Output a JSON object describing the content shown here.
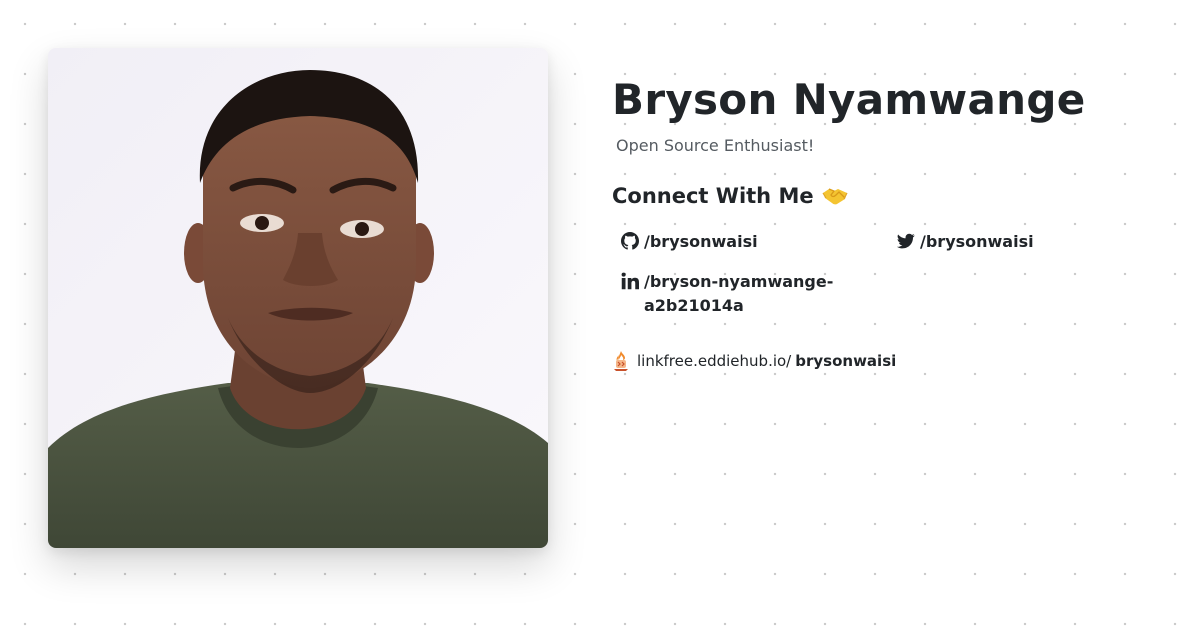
{
  "profile": {
    "name": "Bryson Nyamwange",
    "tagline": "Open Source Enthusiast!",
    "avatar_alt": "profile-photo"
  },
  "connect": {
    "heading": "Connect With Me",
    "emoji_icon": "handshake-icon"
  },
  "socials": [
    {
      "platform": "github",
      "icon": "github-icon",
      "label": "/brysonwaisi"
    },
    {
      "platform": "twitter",
      "icon": "twitter-icon",
      "label": "/brysonwaisi"
    },
    {
      "platform": "linkedin",
      "icon": "linkedin-icon",
      "label": "/bryson-nyamwange-a2b21014a"
    }
  ],
  "linkfree": {
    "icon": "linkfree-logo-icon",
    "domain": "linkfree.eddiehub.io/",
    "handle": "brysonwaisi"
  },
  "colors": {
    "text_primary": "#212529",
    "text_secondary": "#555b61",
    "background": "#ffffff",
    "shirt": "#4a5340"
  }
}
